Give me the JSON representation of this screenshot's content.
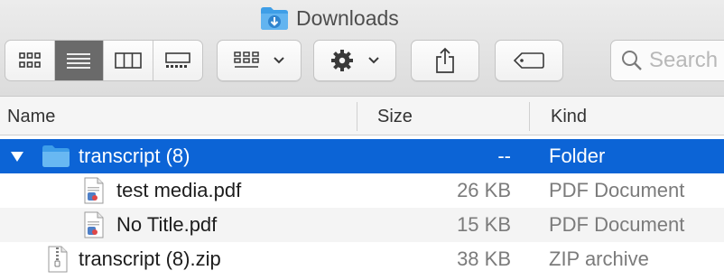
{
  "window": {
    "title": "Downloads",
    "title_icon": "downloads-folder-icon"
  },
  "toolbar": {
    "view_modes": [
      {
        "name": "icon-view",
        "icon": "grid-icon",
        "active": false
      },
      {
        "name": "list-view",
        "icon": "list-icon",
        "active": true
      },
      {
        "name": "column-view",
        "icon": "columns-icon",
        "active": false
      },
      {
        "name": "gallery-view",
        "icon": "gallery-icon",
        "active": false
      }
    ],
    "group_button_icon": "group-grid-icon",
    "action_button_icon": "gear-icon",
    "share_button_icon": "share-icon",
    "tag_button_icon": "tag-icon",
    "search": {
      "placeholder": "Search",
      "icon": "search-icon"
    }
  },
  "columns": {
    "name": "Name",
    "size": "Size",
    "kind": "Kind"
  },
  "files": [
    {
      "name": "transcript (8)",
      "size": "--",
      "kind": "Folder",
      "icon": "folder-icon",
      "expanded": true,
      "selected": true,
      "level": 0
    },
    {
      "name": "test media.pdf",
      "size": "26 KB",
      "kind": "PDF Document",
      "icon": "pdf-icon",
      "level": 1
    },
    {
      "name": "No Title.pdf",
      "size": "15 KB",
      "kind": "PDF Document",
      "icon": "pdf-icon",
      "level": 1
    },
    {
      "name": "transcript (8).zip",
      "size": "38 KB",
      "kind": "ZIP archive",
      "icon": "zip-icon",
      "level": 0
    }
  ],
  "colors": {
    "selection": "#0c64d6",
    "folder": "#5fb0ee",
    "toolbar_active": "#6a6a6a"
  }
}
